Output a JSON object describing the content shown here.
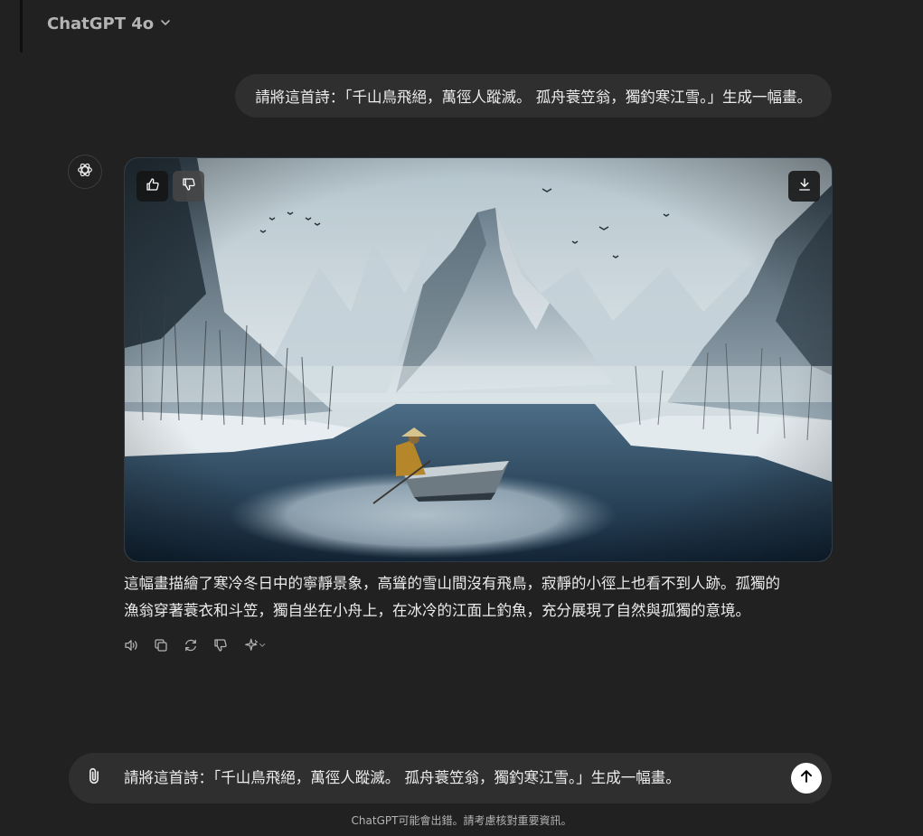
{
  "header": {
    "model_label": "ChatGPT 4o"
  },
  "conversation": {
    "user_message": "請將這首詩：「千山鳥飛絕，萬徑人蹤滅。 孤舟蓑笠翁，獨釣寒江雪。」生成一幅畫。",
    "assistant": {
      "response_lines": [
        "這幅畫描繪了寒冷冬日中的寧靜景象，高聳的雪山間沒有飛鳥，寂靜的小徑上也看不到人跡。孤獨的",
        "漁翁穿著蓑衣和斗笠，獨自坐在小舟上，在冰冷的江面上釣魚，充分展現了自然與孤獨的意境。"
      ],
      "image_buttons": [
        "thumbs-up-icon",
        "thumbs-down-icon",
        "download-icon"
      ],
      "action_icons": [
        "speaker-icon",
        "copy-icon",
        "regenerate-icon",
        "thumbs-down-icon",
        "sparkle-icon"
      ]
    }
  },
  "composer": {
    "input_text": "請將這首詩：「千山鳥飛絕，萬徑人蹤滅。 孤舟蓑笠翁，獨釣寒江雪。」生成一幅畫。",
    "attach_icon": "paperclip-icon",
    "send_icon": "arrow-up-icon"
  },
  "footer": {
    "disclaimer": "ChatGPT可能會出錯。請考慮核對重要資訊。"
  },
  "colors": {
    "background": "#212121",
    "bubble": "#2f2f2f",
    "text": "#ececec",
    "muted": "#b4b4b4"
  }
}
